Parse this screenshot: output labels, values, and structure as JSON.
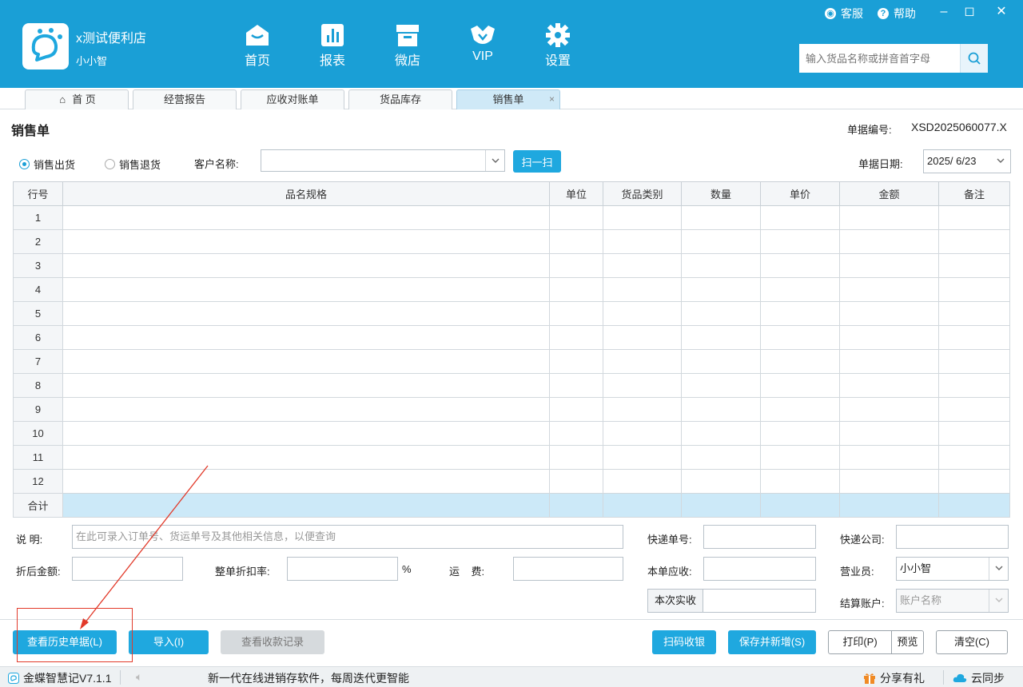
{
  "header": {
    "shop_name": "x测试便利店",
    "user_name": "小小智",
    "nav": [
      {
        "label": "首页",
        "icon": "home-icon"
      },
      {
        "label": "报表",
        "icon": "report-icon"
      },
      {
        "label": "微店",
        "icon": "store-icon"
      },
      {
        "label": "VIP",
        "icon": "vip-crown-icon"
      },
      {
        "label": "设置",
        "icon": "gear-icon"
      }
    ],
    "service_label": "客服",
    "help_label": "帮助",
    "search_placeholder": "输入货品名称或拼音首字母"
  },
  "tabs": [
    {
      "label": "首 页"
    },
    {
      "label": "经营报告"
    },
    {
      "label": "应收对账单"
    },
    {
      "label": "货品库存"
    },
    {
      "label": "销售单",
      "close": "×"
    }
  ],
  "page": {
    "title": "销售单",
    "doc_no_label": "单据编号:",
    "doc_no_value": "XSD2025060077.X"
  },
  "form": {
    "radio_out": "销售出货",
    "radio_return": "销售退货",
    "customer_label": "客户名称:",
    "customer_value": "",
    "scan_label": "扫一扫",
    "date_label": "单据日期:",
    "date_value": "2025/  6/23"
  },
  "grid": {
    "headers": [
      "行号",
      "品名规格",
      "单位",
      "货品类别",
      "数量",
      "单价",
      "金额",
      "备注"
    ],
    "rows": [
      "1",
      "2",
      "3",
      "4",
      "5",
      "6",
      "7",
      "8",
      "9",
      "10",
      "11",
      "12"
    ],
    "total_label": "合计"
  },
  "bottom": {
    "note_label": "说  明:",
    "note_placeholder": "在此可录入订单号、货运单号及其他相关信息，以便查询",
    "express_no_label": "快递单号:",
    "express_co_label": "快递公司:",
    "discount_amount_label": "折后金额:",
    "discount_rate_label": "整单折扣率:",
    "percent": "%",
    "freight_label": "运    费:",
    "receivable_label": "本单应收:",
    "salesman_label": "营业员:",
    "salesman_value": "小小智",
    "actual_btn": "本次实收",
    "account_label": "结算账户:",
    "account_placeholder": "账户名称"
  },
  "actions": {
    "history": "查看历史单据(L)",
    "import": "导入(I)",
    "payment_records": "查看收款记录",
    "scan_cashier": "扫码收银",
    "save_new": "保存并新增(S)",
    "print": "打印(P)",
    "preview": "预览",
    "clear": "清空(C)"
  },
  "status": {
    "version": "金蝶智慧记V7.1.1",
    "slogan": "新一代在线进销存软件，每周迭代更智能",
    "share": "分享有礼",
    "sync": "云同步"
  },
  "colors": {
    "brand": "#1a9fd6",
    "button": "#1fa8df",
    "annotation": "#e23a2a"
  }
}
